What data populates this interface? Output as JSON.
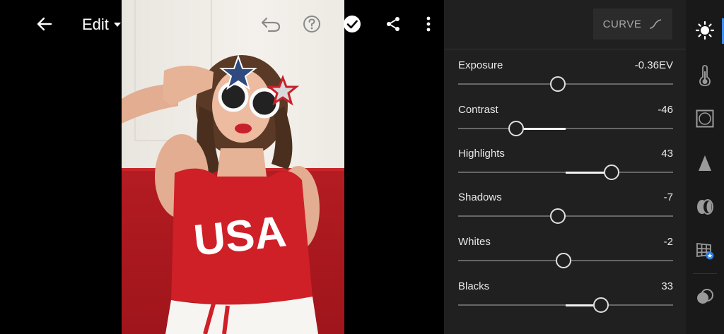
{
  "toolbar": {
    "edit_label": "Edit"
  },
  "panel": {
    "curve_label": "CURVE",
    "sliders": [
      {
        "label": "Exposure",
        "value": "-0.36EV",
        "min": -5,
        "max": 5,
        "num": -0.36
      },
      {
        "label": "Contrast",
        "value": "-46",
        "min": -100,
        "max": 100,
        "num": -46
      },
      {
        "label": "Highlights",
        "value": "43",
        "min": -100,
        "max": 100,
        "num": 43
      },
      {
        "label": "Shadows",
        "value": "-7",
        "min": -100,
        "max": 100,
        "num": -7
      },
      {
        "label": "Whites",
        "value": "-2",
        "min": -100,
        "max": 100,
        "num": -2
      },
      {
        "label": "Blacks",
        "value": "33",
        "min": -100,
        "max": 100,
        "num": 33
      }
    ]
  },
  "photo_text": "USA",
  "rail": {
    "items": [
      "light-icon",
      "color-icon",
      "vignette-icon",
      "sharpen-icon",
      "lens-icon",
      "presets-icon",
      "mask-icon"
    ],
    "active": "light-icon"
  },
  "colors": {
    "accent": "#3d8ef0",
    "panel_bg": "#202020",
    "rail_bg": "#191919"
  }
}
